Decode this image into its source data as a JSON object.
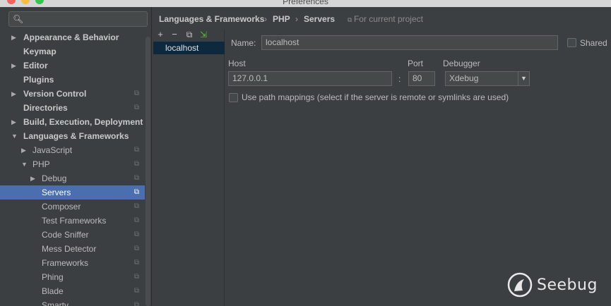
{
  "window": {
    "title": "Preferences"
  },
  "search": {
    "placeholder": "",
    "icon": "search-icon"
  },
  "tree": {
    "items": [
      {
        "label": "Appearance & Behavior",
        "arrow": "▶",
        "bold": true,
        "project": false
      },
      {
        "label": "Keymap",
        "arrow": "",
        "bold": true,
        "project": false
      },
      {
        "label": "Editor",
        "arrow": "▶",
        "bold": true,
        "project": false
      },
      {
        "label": "Plugins",
        "arrow": "",
        "bold": true,
        "project": false
      },
      {
        "label": "Version Control",
        "arrow": "▶",
        "bold": true,
        "project": true
      },
      {
        "label": "Directories",
        "arrow": "",
        "bold": true,
        "project": true
      },
      {
        "label": "Build, Execution, Deployment",
        "arrow": "▶",
        "bold": true,
        "project": false
      },
      {
        "label": "Languages & Frameworks",
        "arrow": "▼",
        "bold": true,
        "project": false
      },
      {
        "label": "JavaScript",
        "arrow": "▶",
        "bold": false,
        "project": true
      },
      {
        "label": "PHP",
        "arrow": "▼",
        "bold": false,
        "project": true
      },
      {
        "label": "Debug",
        "arrow": "▶",
        "bold": false,
        "project": true
      },
      {
        "label": "Servers",
        "arrow": "",
        "bold": false,
        "project": true,
        "selected": true
      },
      {
        "label": "Composer",
        "arrow": "",
        "bold": false,
        "project": true
      },
      {
        "label": "Test Frameworks",
        "arrow": "",
        "bold": false,
        "project": true
      },
      {
        "label": "Code Sniffer",
        "arrow": "",
        "bold": false,
        "project": true
      },
      {
        "label": "Mess Detector",
        "arrow": "",
        "bold": false,
        "project": true
      },
      {
        "label": "Frameworks",
        "arrow": "",
        "bold": false,
        "project": true
      },
      {
        "label": "Phing",
        "arrow": "",
        "bold": false,
        "project": true
      },
      {
        "label": "Blade",
        "arrow": "",
        "bold": false,
        "project": true
      },
      {
        "label": "Smarty",
        "arrow": "",
        "bold": false,
        "project": true
      }
    ]
  },
  "breadcrumb": {
    "items": [
      "Languages & Frameworks",
      "PHP",
      "Servers"
    ],
    "separator": "›",
    "scope": "For current project"
  },
  "servers": {
    "toolbar": {
      "add": "+",
      "remove": "−",
      "copy": "⧉",
      "import": "⇲"
    },
    "items": [
      "localhost"
    ]
  },
  "form": {
    "name_label": "Name:",
    "name_value": "localhost",
    "shared_label": "Shared",
    "host_label": "Host",
    "host_value": "127.0.0.1",
    "colon": ":",
    "port_label": "Port",
    "port_value": "80",
    "debugger_label": "Debugger",
    "debugger_value": "Xdebug",
    "path_mappings_label": "Use path mappings (select if the server is remote or symlinks are used)"
  },
  "watermark": {
    "text": "Seebug"
  },
  "colors": {
    "selection": "#4b6eaf",
    "background": "#3c3f41",
    "list_selection": "#0d293e"
  }
}
